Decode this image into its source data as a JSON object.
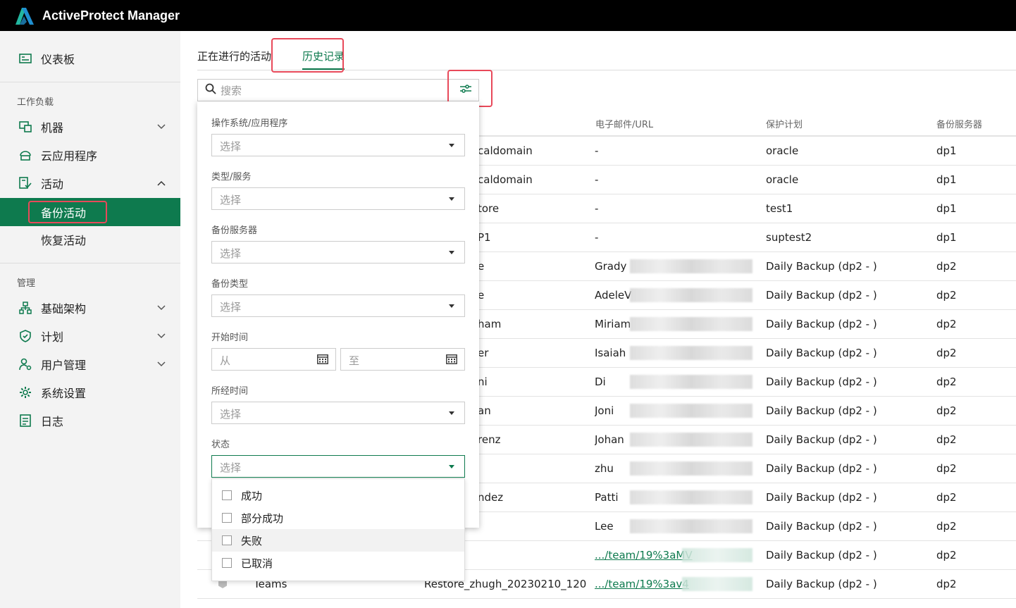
{
  "app": {
    "title": "ActiveProtect Manager"
  },
  "colors": {
    "accent": "#0e7a4e",
    "highlight": "#e8495a",
    "topbar": "#000000"
  },
  "sidebar": {
    "dashboard": "仪表板",
    "workload_label": "工作负载",
    "machines": "机器",
    "cloud_apps": "云应用程序",
    "activity": "活动",
    "backup_activity": "备份活动",
    "restore_activity": "恢复活动",
    "manage_label": "管理",
    "infrastructure": "基础架构",
    "plans": "计划",
    "user_management": "用户管理",
    "system_settings": "系统设置",
    "logs": "日志"
  },
  "tabs": {
    "ongoing": "正在进行的活动",
    "history": "历史记录"
  },
  "search": {
    "placeholder": "搜索"
  },
  "table": {
    "headers": {
      "email": "电子邮件/URL",
      "plan": "保护计划",
      "server": "备份服务器"
    },
    "rows": [
      {
        "name": "caldomain",
        "email": "-",
        "plan": "oracle",
        "server": "dp1"
      },
      {
        "name": "caldomain",
        "email": "-",
        "plan": "oracle",
        "server": "dp1"
      },
      {
        "name": "tore",
        "email": "-",
        "plan": "test1",
        "server": "dp1"
      },
      {
        "name": "P1",
        "email": "-",
        "plan": "suptest2",
        "server": "dp1"
      },
      {
        "name": "e",
        "email": "Grady",
        "plan": "Daily Backup (dp2 - )",
        "server": "dp2"
      },
      {
        "name": "e",
        "email": "AdeleV",
        "plan": "Daily Backup (dp2 - )",
        "server": "dp2"
      },
      {
        "name": "ham",
        "email": "Miriam",
        "plan": "Daily Backup (dp2 - )",
        "server": "dp2"
      },
      {
        "name": "er",
        "email": "Isaiah",
        "plan": "Daily Backup (dp2 - )",
        "server": "dp2"
      },
      {
        "name": "ni",
        "email": "Di",
        "plan": "Daily Backup (dp2 - )",
        "server": "dp2"
      },
      {
        "name": "an",
        "email": "Joni",
        "plan": "Daily Backup (dp2 - )",
        "server": "dp2"
      },
      {
        "name": "renz",
        "email": "Johan",
        "plan": "Daily Backup (dp2 - )",
        "server": "dp2"
      },
      {
        "name": "",
        "email": "zhu",
        "plan": "Daily Backup (dp2 - )",
        "server": "dp2"
      },
      {
        "name": "ndez",
        "email": "Patti",
        "plan": "Daily Backup (dp2 - )",
        "server": "dp2"
      },
      {
        "name": "",
        "email": "Lee",
        "plan": "Daily Backup (dp2 - )",
        "server": "dp2"
      },
      {
        "name": "",
        "email": ".../team/19%3aMV",
        "plan": "Daily Backup (dp2 - )",
        "server": "dp2"
      },
      {
        "type": "Teams",
        "name": "Restore_zhugh_20230210_120...",
        "email": ".../team/19%3av4",
        "plan": "Daily Backup (dp2 - )",
        "server": "dp2"
      }
    ]
  },
  "filter_panel": {
    "os_label": "操作系统/应用程序",
    "type_label": "类型/服务",
    "server_label": "备份服务器",
    "backup_type_label": "备份类型",
    "start_time_label": "开始时间",
    "duration_label": "所经时间",
    "status_label": "状态",
    "select_placeholder": "选择",
    "from_placeholder": "从",
    "to_placeholder": "至",
    "status_options": [
      "成功",
      "部分成功",
      "失败",
      "已取消"
    ]
  }
}
